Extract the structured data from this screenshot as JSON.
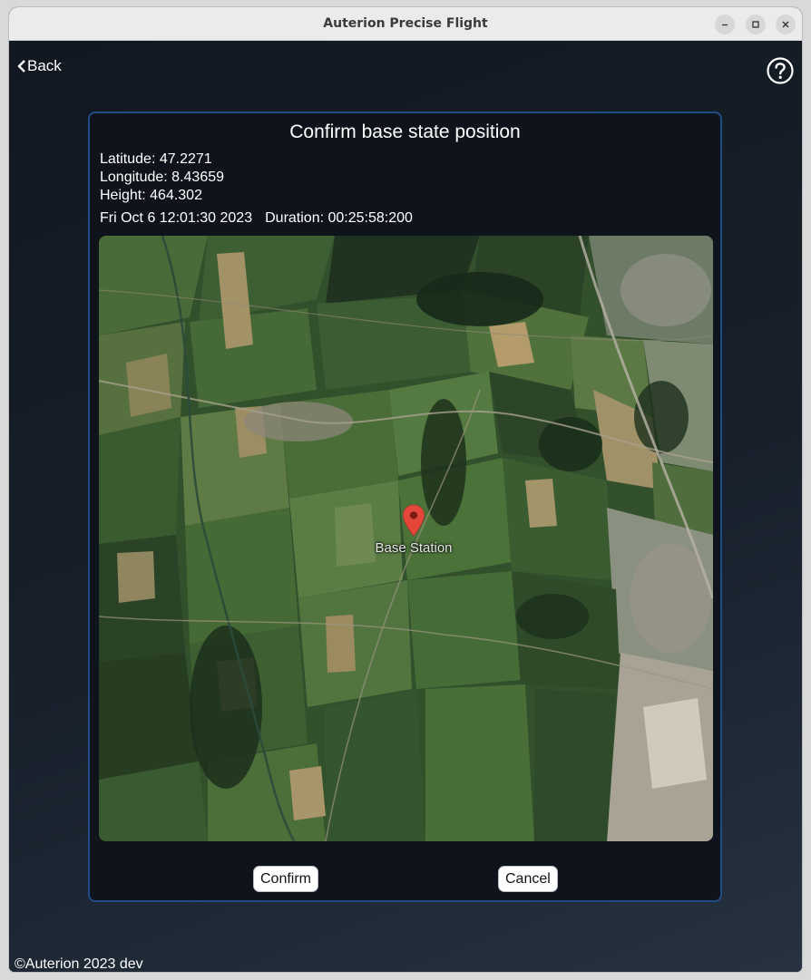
{
  "window": {
    "title": "Auterion Precise Flight",
    "controls": [
      "minimize-icon",
      "maximize-icon",
      "close-icon"
    ]
  },
  "nav": {
    "back_label": "Back",
    "back_icon": "chevron-left-icon",
    "help_icon": "question-circle-icon"
  },
  "dialog": {
    "title": "Confirm base state position",
    "latitude": "Latitude: 47.2271",
    "longitude": "Longitude: 8.43659",
    "height": "Height: 464.302",
    "timestamp": "Fri Oct 6 12:01:30 2023",
    "duration": "Duration: 00:25:58:200",
    "map": {
      "marker_label": "Base Station",
      "marker_icon": "map-pin-icon",
      "marker_color": "#e5483b"
    },
    "confirm_label": "Confirm",
    "cancel_label": "Cancel"
  },
  "footer": {
    "copyright": "©Auterion 2023 dev"
  },
  "colors": {
    "dialog_border": "#1f4c86",
    "dialog_bg": "#0f141c",
    "app_bg": "#17202b"
  }
}
